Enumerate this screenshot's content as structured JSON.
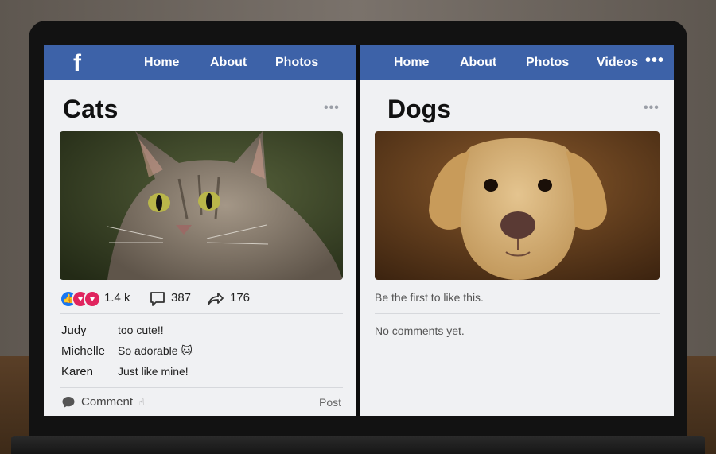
{
  "left_panel": {
    "nav": {
      "logo": "f",
      "items": [
        "Home",
        "About",
        "Photos"
      ]
    },
    "title": "Cats",
    "more_icon": "ellipsis-icon",
    "stats": {
      "reactions": "1.4 k",
      "comments": "387",
      "shares": "176"
    },
    "comments": [
      {
        "name": "Judy",
        "text": "too cute!!"
      },
      {
        "name": "Michelle",
        "text": "So adorable 🐱"
      },
      {
        "name": "Karen",
        "text": "Just like mine!"
      }
    ],
    "comment_label": "Comment",
    "comment_cursor": "☝",
    "post_label": "Post"
  },
  "right_panel": {
    "nav": {
      "items": [
        "Home",
        "About",
        "Photos",
        "Videos"
      ],
      "more": "•••"
    },
    "title": "Dogs",
    "more_icon": "ellipsis-icon",
    "likes_text": "Be the first to like this.",
    "comments_text": "No comments yet."
  },
  "colors": {
    "nav_blue": "#3d62a8",
    "panel_bg": "#f0f1f3",
    "like_blue": "#1877f2",
    "heart_red": "#e0245e"
  }
}
